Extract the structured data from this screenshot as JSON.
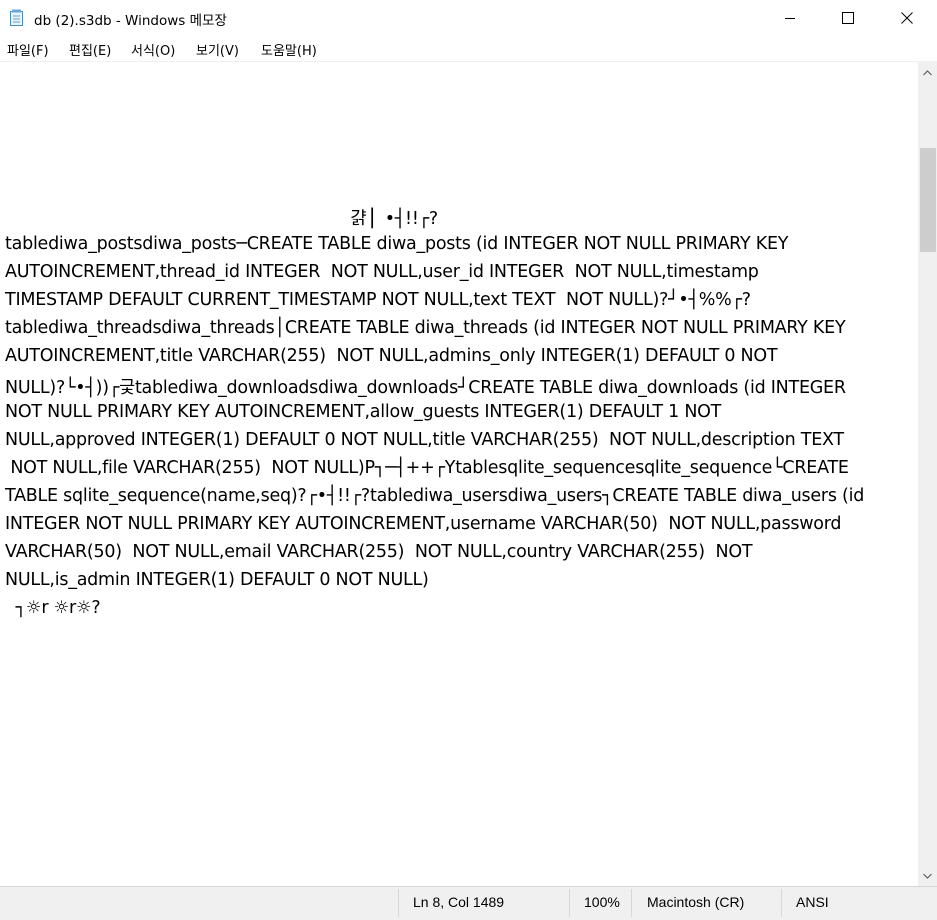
{
  "window": {
    "title": "db (2).s3db - Windows 메모장",
    "app_icon": "notepad-icon"
  },
  "controls": {
    "minimize_icon": "minimize-icon",
    "maximize_icon": "maximize-icon",
    "close_icon": "close-icon"
  },
  "menu": {
    "items": [
      "파일(F)",
      "편집(E)",
      "서식(O)",
      "보기(V)",
      "도움말(H)"
    ]
  },
  "editor": {
    "lines": [
      "                                                                 걁 ▏•┤!!┌?",
      "tablediwa_postsdiwa_posts─CREATE TABLE diwa_posts (id INTEGER NOT NULL PRIMARY KEY",
      "AUTOINCREMENT,thread_id INTEGER  NOT NULL,user_id INTEGER  NOT NULL,timestamp",
      "TIMESTAMP DEFAULT CURRENT_TIMESTAMP NOT NULL,text TEXT  NOT NULL)?┘•┤%%┌?",
      "tablediwa_threadsdiwa_threads│CREATE TABLE diwa_threads (id INTEGER NOT NULL PRIMARY KEY",
      "AUTOINCREMENT,title VARCHAR(255)  NOT NULL,admins_only INTEGER(1) DEFAULT 0 NOT",
      "NULL)?└•┤))┌긏tablediwa_downloadsdiwa_downloads┘CREATE TABLE diwa_downloads (id INTEGER",
      "NOT NULL PRIMARY KEY AUTOINCREMENT,allow_guests INTEGER(1) DEFAULT 1 NOT",
      "NULL,approved INTEGER(1) DEFAULT 0 NOT NULL,title VARCHAR(255)  NOT NULL,description TEXT",
      " NOT NULL,file VARCHAR(255)  NOT NULL)P┐─┤++┌Ytablesqlite_sequencesqlite_sequence└CREATE",
      "TABLE sqlite_sequence(name,seq)?┌•┤!!┌?tablediwa_usersdiwa_users┐CREATE TABLE diwa_users (id",
      "INTEGER NOT NULL PRIMARY KEY AUTOINCREMENT,username VARCHAR(50)  NOT NULL,password",
      "VARCHAR(50)  NOT NULL,email VARCHAR(255)  NOT NULL,country VARCHAR(255)  NOT",
      "NULL,is_admin INTEGER(1) DEFAULT 0 NOT NULL)",
      "  ┐☼r ☼r☼?"
    ]
  },
  "scrollbar": {
    "up_icon": "scroll-up-icon",
    "down_icon": "scroll-down-icon"
  },
  "status": {
    "position": "Ln 8, Col 1489",
    "zoom": "100%",
    "line_ending": "Macintosh (CR)",
    "encoding": "ANSI"
  }
}
